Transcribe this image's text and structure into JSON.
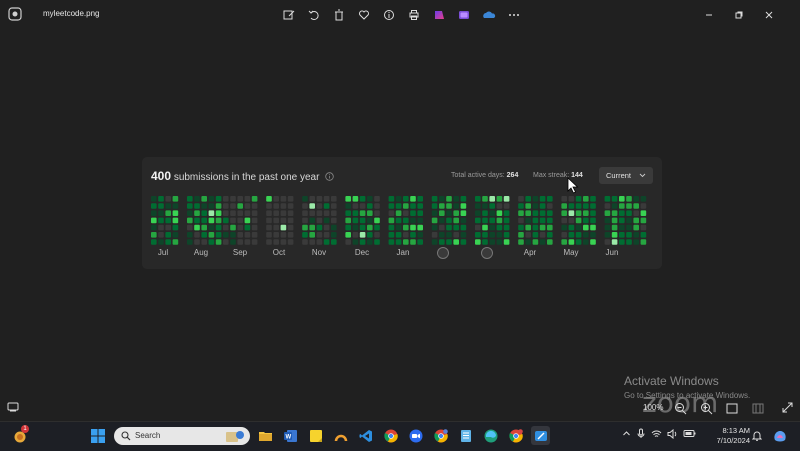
{
  "window": {
    "title": "myleetcode.png",
    "toolbar_icons": [
      "edit-icon",
      "rotate-icon",
      "delete-icon",
      "favorite-icon",
      "info-icon",
      "print-icon",
      "clipchamp-icon",
      "photos-icon",
      "onedrive-icon",
      "more-icon"
    ],
    "window_buttons": [
      "minimize-icon",
      "restore-icon",
      "close-icon"
    ]
  },
  "card": {
    "count": "400",
    "heading_text": "submissions in the past one year",
    "active_days_label": "Total active days:",
    "active_days_value": "264",
    "max_streak_label": "Max streak:",
    "max_streak_value": "144",
    "dropdown_value": "Current",
    "months": [
      "Jul",
      "Aug",
      "Sep",
      "Oct",
      "Nov",
      "Dec",
      "Jan",
      "Apr",
      "May",
      "Jun"
    ],
    "colors": {
      "empty": "#3a3a3a",
      "level1": "#0e4429",
      "level2": "#006d32",
      "level3": "#26a641",
      "level4": "#39d353",
      "level5": "#9be9a8"
    }
  },
  "overlay": {
    "activate_line1": "Activate Windows",
    "activate_line2": "Go to Settings to activate Windows.",
    "zoom_level": "100%",
    "zoom_logo": "zoom"
  },
  "taskbar": {
    "notification_count": "1",
    "search_placeholder": "Search",
    "apps": [
      "file-explorer-icon",
      "word-icon",
      "sticky-notes-icon",
      "arc-icon",
      "vscode-icon",
      "chrome-icon",
      "zoom-app-icon",
      "chrome-profile-icon",
      "notepad-icon",
      "edge-icon",
      "chrome-alt-icon",
      "snipping-tool-icon"
    ],
    "time": "8:13 AM",
    "date": "7/10/2024"
  }
}
